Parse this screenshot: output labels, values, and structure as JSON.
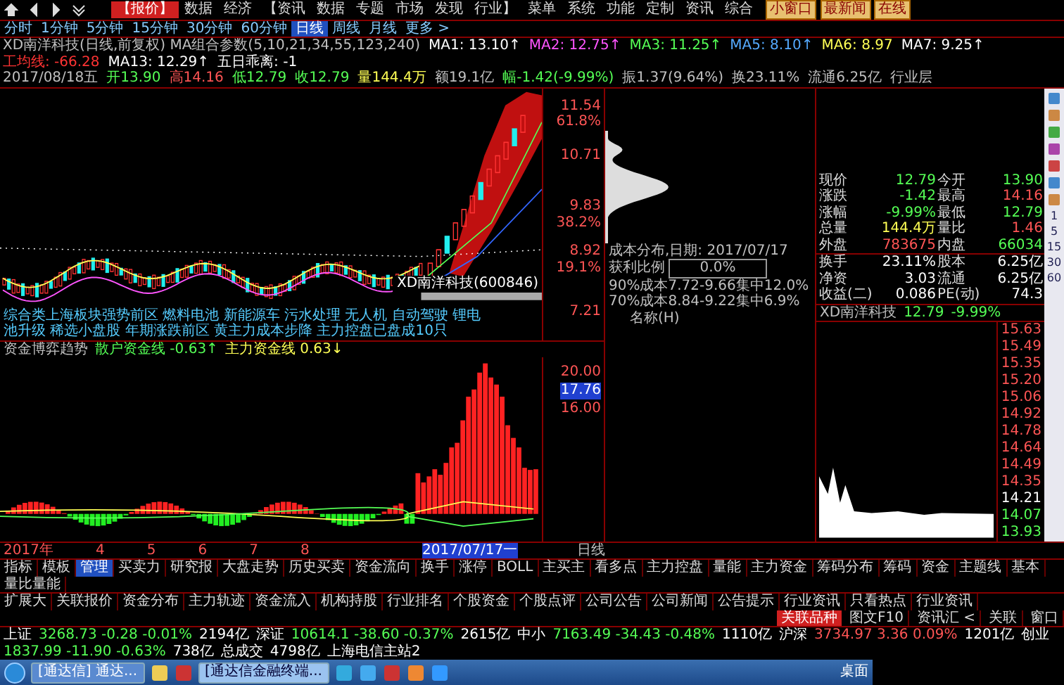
{
  "top_menu": {
    "items": [
      {
        "label": "【报价】",
        "selected": true
      },
      {
        "label": "数据",
        "selected": false
      },
      {
        "label": "经济",
        "selected": false
      },
      {
        "label": "【资讯",
        "selected": false
      },
      {
        "label": "数据",
        "selected": false
      },
      {
        "label": "专题",
        "selected": false
      },
      {
        "label": "市场",
        "selected": false
      },
      {
        "label": "发现",
        "selected": false
      },
      {
        "label": "行业】",
        "selected": false
      },
      {
        "label": "菜单",
        "selected": false
      },
      {
        "label": "系统",
        "selected": false
      },
      {
        "label": "功能",
        "selected": false
      },
      {
        "label": "定制",
        "selected": false
      },
      {
        "label": "资讯",
        "selected": false
      },
      {
        "label": "综合",
        "selected": false
      }
    ],
    "buttons": [
      "小窗口",
      "最新闻",
      "在线"
    ]
  },
  "period_tabs": [
    {
      "label": "分时",
      "selected": false
    },
    {
      "label": "1分钟",
      "selected": false
    },
    {
      "label": "5分钟",
      "selected": false
    },
    {
      "label": "15分钟",
      "selected": false
    },
    {
      "label": "30分钟",
      "selected": false
    },
    {
      "label": "60分钟",
      "selected": false
    },
    {
      "label": "日线",
      "selected": true
    },
    {
      "label": "周线",
      "selected": false
    },
    {
      "label": "月线",
      "selected": false
    },
    {
      "label": "更多 >",
      "selected": false
    }
  ],
  "ma_line": [
    {
      "text": "XD南洋科技(日线,前复权) MA组合参数(5,10,21,34,55,123,240)",
      "color": "#c0c0c0"
    },
    {
      "text": "MA1: 13.10↑",
      "color": "#ffffff"
    },
    {
      "text": "MA2: 12.75↑",
      "color": "#ff55ff"
    },
    {
      "text": "MA3: 11.25↑",
      "color": "#55ff55"
    },
    {
      "text": "MA5: 8.10↑",
      "color": "#55aaff"
    },
    {
      "text": "MA6: 8.97",
      "color": "#ffff55"
    },
    {
      "text": "MA7: 9.25↑",
      "color": "#ffffff"
    },
    {
      "text": "工均线: -66.28",
      "color": "#ff3333"
    },
    {
      "text": "MA13: 12.29↑",
      "color": "#ffffff"
    },
    {
      "text": "五日乖离: -1",
      "color": "#ffffff"
    }
  ],
  "bar_info": [
    {
      "text": "2017/08/18五",
      "color": "#c0c0c0"
    },
    {
      "text": "开13.90",
      "color": "#55ff55"
    },
    {
      "text": "高14.16",
      "color": "#ff5555"
    },
    {
      "text": "低12.79",
      "color": "#55ff55"
    },
    {
      "text": "收12.79",
      "color": "#55ff55"
    },
    {
      "text": "量144.4万",
      "color": "#ffff55"
    },
    {
      "text": "额19.1亿",
      "color": "#c0c0c0"
    },
    {
      "text": "幅-1.42(-9.99%)",
      "color": "#55ff55"
    },
    {
      "text": "振1.37(9.64%)",
      "color": "#c0c0c0"
    },
    {
      "text": "换23.11%",
      "color": "#c0c0c0"
    },
    {
      "text": "流通6.25亿",
      "color": "#c0c0c0"
    },
    {
      "text": "行业层",
      "color": "#c0c0c0"
    }
  ],
  "main_chart": {
    "price_labels": [
      {
        "price": "11.54",
        "pct": "61.8%"
      },
      {
        "price": "10.71"
      },
      {
        "price": "9.83",
        "pct": "38.2%"
      },
      {
        "price": "8.92",
        "pct": "19.1%"
      },
      {
        "price": "7.21"
      }
    ],
    "sector_text": "综合类上海板块强势前区 燃料电池 新能源车 污水处理 无人机 自动驾驶 锂电池升级 稀选小盘股 年期涨跌前区 黄主力成本步降 主力控盘已盘成10只",
    "stock_label": "XD南洋科技(600846)"
  },
  "cost_distribution": {
    "date_label": "成本分布,日期: 2017/07/17",
    "profit_label": "获利比例",
    "profit_value": "0.0%",
    "lines": [
      "90%成本7.72-9.66集中12.0%",
      "70%成本8.84-9.22集中6.9%"
    ],
    "name_label": "名称(H)"
  },
  "quote": {
    "rows": [
      [
        {
          "text": "现价"
        },
        {
          "text": "12.79",
          "color": "#55ff55"
        },
        {
          "text": "今开"
        },
        {
          "text": "13.90",
          "color": "#55ff55"
        }
      ],
      [
        {
          "text": "涨跌"
        },
        {
          "text": "-1.42",
          "color": "#55ff55"
        },
        {
          "text": "最高"
        },
        {
          "text": "14.16",
          "color": "#ff5555"
        }
      ],
      [
        {
          "text": "涨幅"
        },
        {
          "text": "-9.99%",
          "color": "#55ff55"
        },
        {
          "text": "最低"
        },
        {
          "text": "12.79",
          "color": "#55ff55"
        }
      ],
      [
        {
          "text": "总量"
        },
        {
          "text": "144.4万",
          "color": "#ffff55"
        },
        {
          "text": "量比"
        },
        {
          "text": "1.46",
          "color": "#ff5555"
        }
      ],
      [
        {
          "text": "外盘"
        },
        {
          "text": "783675",
          "color": "#ff5555"
        },
        {
          "text": "内盘"
        },
        {
          "text": "66034",
          "color": "#55ff55"
        }
      ],
      [
        {
          "text": "换手"
        },
        {
          "text": "23.11%",
          "color": "#ffffff"
        },
        {
          "text": "股本"
        },
        {
          "text": "6.25亿",
          "color": "#ffffff"
        }
      ],
      [
        {
          "text": "净资"
        },
        {
          "text": "3.03",
          "color": "#ffffff"
        },
        {
          "text": "流通"
        },
        {
          "text": "6.25亿",
          "color": "#ffffff"
        }
      ],
      [
        {
          "text": "收益(二)"
        },
        {
          "text": "0.086",
          "color": "#ffffff"
        },
        {
          "text": "PE(动)"
        },
        {
          "text": "74.3",
          "color": "#ffffff"
        }
      ]
    ],
    "header_name": "XD南洋科技",
    "header_price": "12.79",
    "header_change": "-9.99%"
  },
  "minute_axis": [
    {
      "text": "15.63",
      "color": "#ff5555"
    },
    {
      "text": "15.49",
      "color": "#ff5555"
    },
    {
      "text": "15.35",
      "color": "#ff5555"
    },
    {
      "text": "15.20",
      "color": "#ff5555"
    },
    {
      "text": "15.06",
      "color": "#ff5555"
    },
    {
      "text": "14.92",
      "color": "#ff5555"
    },
    {
      "text": "14.78",
      "color": "#ff5555"
    },
    {
      "text": "14.64",
      "color": "#ff5555"
    },
    {
      "text": "14.49",
      "color": "#ff5555"
    },
    {
      "text": "14.35",
      "color": "#ff5555"
    },
    {
      "text": "14.21",
      "color": "#ffffff"
    },
    {
      "text": "14.07",
      "color": "#55ff55"
    },
    {
      "text": "13.93",
      "color": "#55ff55"
    }
  ],
  "side_toolbar": [
    "1",
    "5",
    "15",
    "30",
    "60"
  ],
  "indicator_pane": {
    "title": "资金博弈趋势",
    "series": [
      {
        "name": "散户资金线",
        "value": "-0.63↑",
        "color": "#55ff55"
      },
      {
        "name": "主力资金线",
        "value": "0.63↓",
        "color": "#ffff55"
      }
    ],
    "axis_labels": [
      {
        "text": "20.00",
        "kind": "tick"
      },
      {
        "text": "17.76",
        "kind": "cursor"
      },
      {
        "text": "16.00",
        "kind": "tick"
      }
    ]
  },
  "time_axis": {
    "labels": [
      "2017年",
      "4",
      "5",
      "6",
      "7",
      "8"
    ],
    "cursor_date": "2017/07/17一",
    "period_label": "日线"
  },
  "bottom_tabs": {
    "row1": [
      {
        "label": "指标",
        "selected": false
      },
      {
        "label": "模板",
        "selected": false
      },
      {
        "label": "管理",
        "selected": true
      },
      {
        "label": "买卖力",
        "selected": false
      },
      {
        "label": "研究报",
        "selected": false
      },
      {
        "label": "大盘走势",
        "selected": false
      },
      {
        "label": "历史买卖",
        "selected": false
      },
      {
        "label": "资金流向",
        "selected": false
      },
      {
        "label": "换手",
        "selected": false
      },
      {
        "label": "涨停",
        "selected": false
      },
      {
        "label": "BOLL",
        "selected": false
      },
      {
        "label": "主买主",
        "selected": false
      },
      {
        "label": "看多点",
        "selected": false
      },
      {
        "label": "主力控盘",
        "selected": false
      },
      {
        "label": "量能",
        "selected": false
      },
      {
        "label": "主力资金",
        "selected": false
      },
      {
        "label": "筹码分布",
        "selected": false
      },
      {
        "label": "筹码",
        "selected": false
      },
      {
        "label": "资金",
        "selected": false
      },
      {
        "label": "主题线",
        "selected": false
      },
      {
        "label": "基本",
        "selected": false
      },
      {
        "label": "量比量能",
        "selected": false
      }
    ],
    "row2": [
      {
        "label": "扩展大",
        "selected": false
      },
      {
        "label": "关联报价",
        "selected": false
      },
      {
        "label": "资金分布",
        "selected": false
      },
      {
        "label": "主力轨迹",
        "selected": false
      },
      {
        "label": "资金流入",
        "selected": false
      },
      {
        "label": "机构持股",
        "selected": false
      },
      {
        "label": "行业排名",
        "selected": false
      },
      {
        "label": "个股资金",
        "selected": false
      },
      {
        "label": "个股点评",
        "selected": false
      },
      {
        "label": "公司公告",
        "selected": false
      },
      {
        "label": "公司新闻",
        "selected": false
      },
      {
        "label": "公告提示",
        "selected": false
      },
      {
        "label": "行业资讯",
        "selected": false
      },
      {
        "label": "只看热点",
        "selected": false
      },
      {
        "label": "行业资讯",
        "selected": false
      }
    ],
    "right_buttons": [
      "图文F10",
      "资讯汇 <",
      "关联",
      "窗口"
    ],
    "related_button": "关联品种"
  },
  "status_bar": [
    {
      "text": "上证",
      "color": "#ffffff"
    },
    {
      "text": "3268.73 -0.28 -0.01%",
      "color": "#55ff55"
    },
    {
      "text": "2194亿",
      "color": "#ffffff"
    },
    {
      "text": "深证",
      "color": "#ffffff"
    },
    {
      "text": "10614.1 -38.60 -0.37%",
      "color": "#55ff55"
    },
    {
      "text": "2615亿",
      "color": "#ffffff"
    },
    {
      "text": "中小",
      "color": "#ffffff"
    },
    {
      "text": "7163.49 -34.43 -0.48%",
      "color": "#55ff55"
    },
    {
      "text": "1110亿",
      "color": "#ffffff"
    },
    {
      "text": "沪深",
      "color": "#ffffff"
    },
    {
      "text": "3734.97 3.36 0.09%",
      "color": "#ff5555"
    },
    {
      "text": "1201亿",
      "color": "#ffffff"
    },
    {
      "text": "创业",
      "color": "#ffffff"
    },
    {
      "text": "1837.99 -11.90 -0.63%",
      "color": "#55ff55"
    },
    {
      "text": "738亿",
      "color": "#ffffff"
    },
    {
      "text": "总成交",
      "color": "#ffffff"
    },
    {
      "text": "4798亿",
      "color": "#ffffff"
    },
    {
      "text": "上海电信主站2",
      "color": "#ffffff"
    }
  ],
  "taskbar": {
    "windows": [
      {
        "label": "[通达信] 通达...",
        "selected": false
      },
      {
        "label": "[通达信金融终端...",
        "selected": true
      }
    ],
    "tray_label": "桌面"
  }
}
